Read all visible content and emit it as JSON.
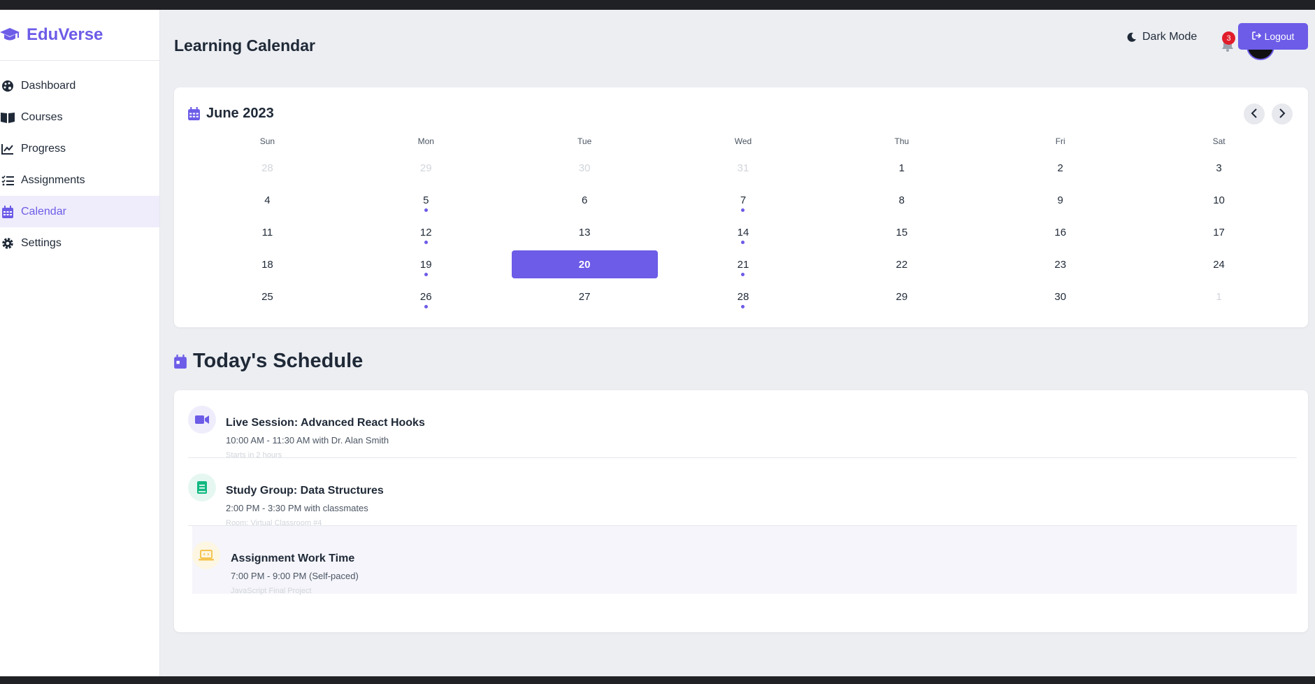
{
  "brand": {
    "name": "EduVerse"
  },
  "sidebar": {
    "items": [
      {
        "label": "Dashboard",
        "icon": "palette-icon"
      },
      {
        "label": "Courses",
        "icon": "book-icon"
      },
      {
        "label": "Progress",
        "icon": "chart-line-icon"
      },
      {
        "label": "Assignments",
        "icon": "tasks-icon"
      },
      {
        "label": "Calendar",
        "icon": "calendar-icon",
        "active": true
      },
      {
        "label": "Settings",
        "icon": "gear-icon"
      }
    ]
  },
  "header": {
    "title": "Learning Calendar",
    "dark_mode_label": "Dark Mode",
    "notification_count": "3",
    "logout_label": "Logout"
  },
  "calendar": {
    "month_label": "June 2023",
    "weekdays": [
      "Sun",
      "Mon",
      "Tue",
      "Wed",
      "Thu",
      "Fri",
      "Sat"
    ],
    "days": [
      {
        "d": "28",
        "muted": true
      },
      {
        "d": "29",
        "muted": true
      },
      {
        "d": "30",
        "muted": true
      },
      {
        "d": "31",
        "muted": true
      },
      {
        "d": "1"
      },
      {
        "d": "2"
      },
      {
        "d": "3"
      },
      {
        "d": "4"
      },
      {
        "d": "5",
        "event": true
      },
      {
        "d": "6"
      },
      {
        "d": "7",
        "event": true
      },
      {
        "d": "8"
      },
      {
        "d": "9"
      },
      {
        "d": "10"
      },
      {
        "d": "11"
      },
      {
        "d": "12",
        "event": true
      },
      {
        "d": "13"
      },
      {
        "d": "14",
        "event": true
      },
      {
        "d": "15"
      },
      {
        "d": "16"
      },
      {
        "d": "17"
      },
      {
        "d": "18"
      },
      {
        "d": "19",
        "event": true
      },
      {
        "d": "20",
        "today": true
      },
      {
        "d": "21",
        "event": true
      },
      {
        "d": "22"
      },
      {
        "d": "23"
      },
      {
        "d": "24"
      },
      {
        "d": "25"
      },
      {
        "d": "26",
        "event": true
      },
      {
        "d": "27"
      },
      {
        "d": "28",
        "event": true
      },
      {
        "d": "29"
      },
      {
        "d": "30"
      },
      {
        "d": "1",
        "muted": true
      }
    ]
  },
  "schedule": {
    "title": "Today's Schedule",
    "events": [
      {
        "title": "Live Session: Advanced React Hooks",
        "time": "10:00 AM - 11:30 AM with Dr. Alan Smith",
        "meta": "Starts in 2 hours",
        "icon": "video-icon",
        "icon_color": "#6c5ce7",
        "icon_bg": "#efedfb"
      },
      {
        "title": "Study Group: Data Structures",
        "time": "2:00 PM - 3:30 PM with classmates",
        "meta": "Room: Virtual Classroom #4",
        "icon": "book-icon",
        "icon_color": "#10b981",
        "icon_bg": "#e6f7f1"
      },
      {
        "title": "Assignment Work Time",
        "time": "7:00 PM - 9:00 PM (Self-paced)",
        "meta": "JavaScript Final Project",
        "icon": "laptop-icon",
        "icon_color": "#f5c451",
        "icon_bg": "#fdf6e3"
      }
    ]
  },
  "colors": {
    "accent": "#6c5ce7",
    "badge": "#e11d2b"
  }
}
